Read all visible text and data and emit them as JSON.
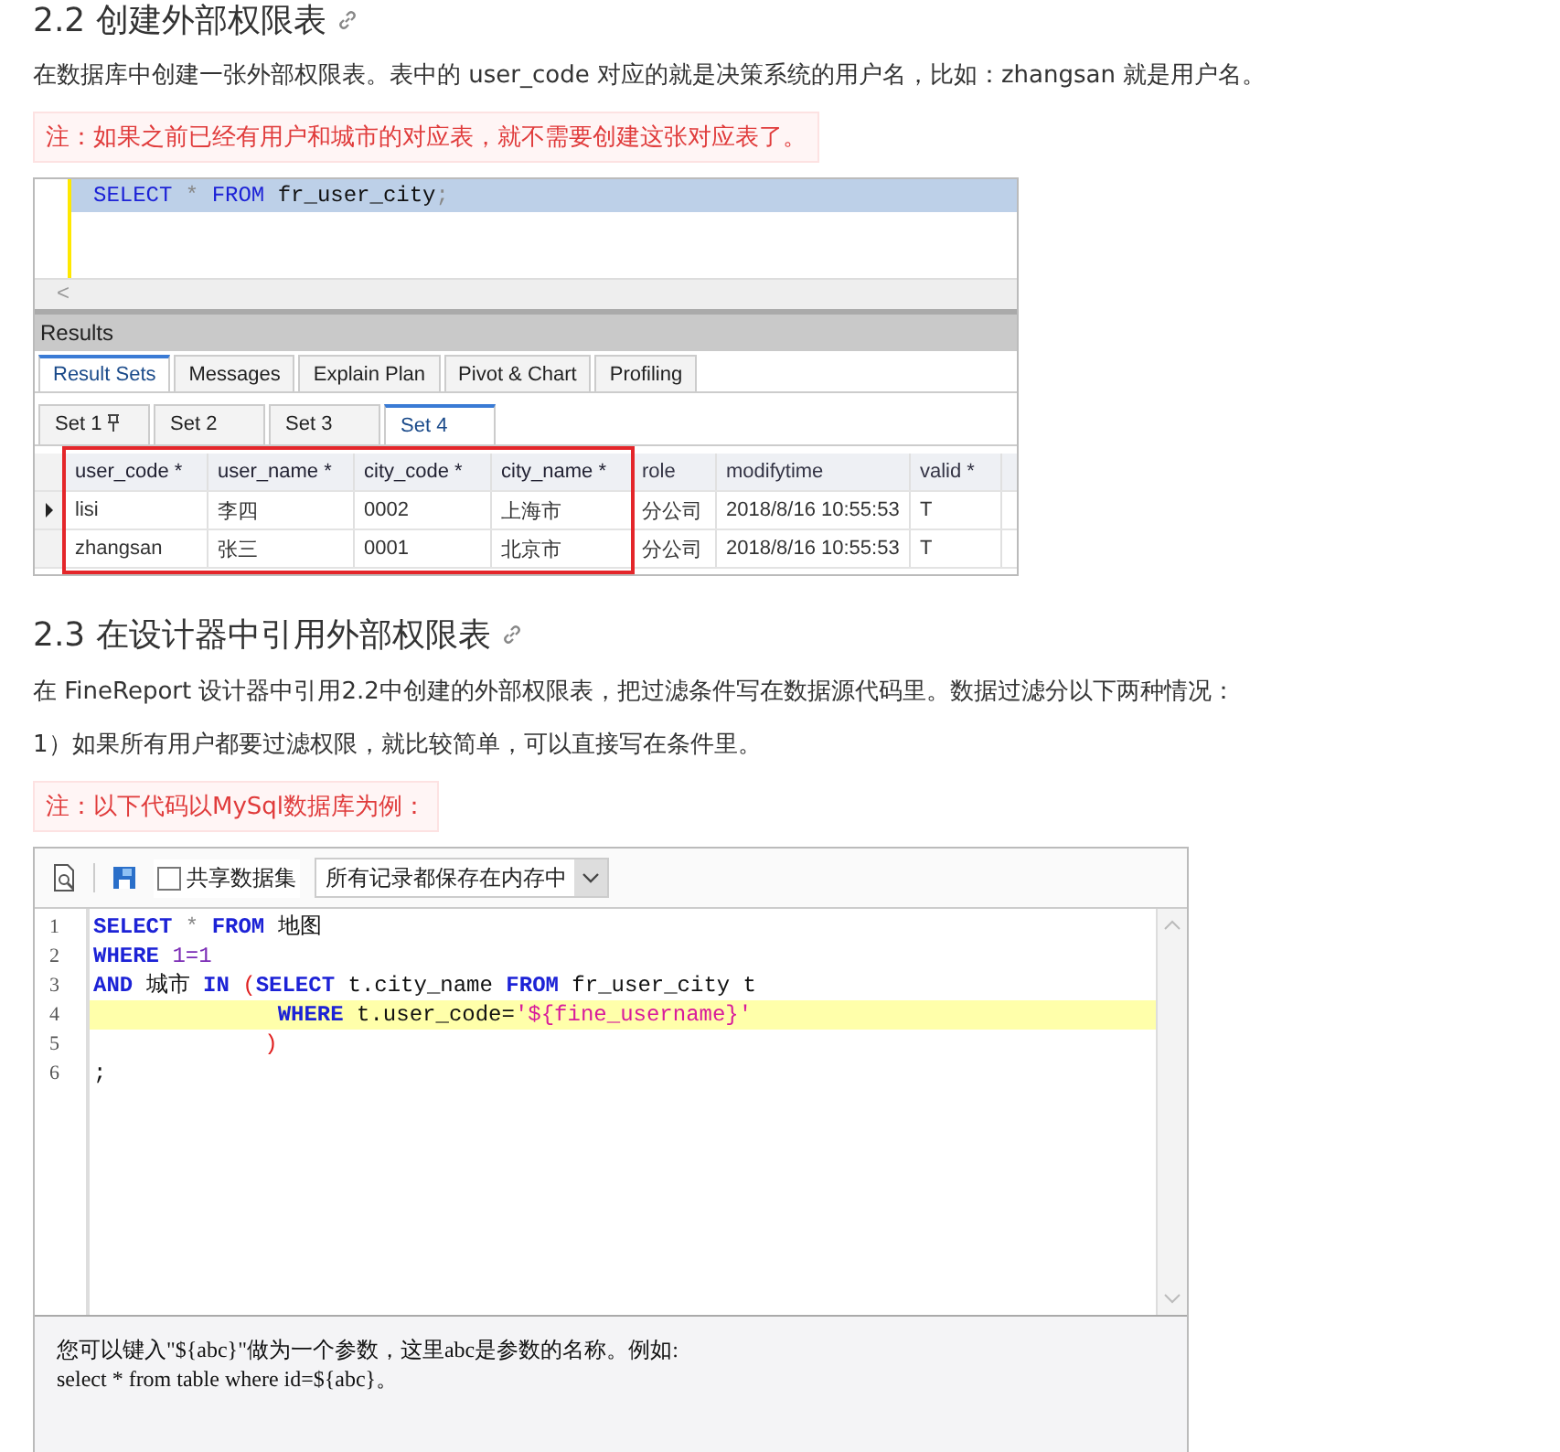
{
  "section_2_2": {
    "heading": "2.2 创建外部权限表",
    "paragraph": "在数据库中创建一张外部权限表。表中的 user_code 对应的就是决策系统的用户名，比如：zhangsan 就是用户名。",
    "note": "注：如果之前已经有用户和城市的对应表，就不需要创建这张对应表了。"
  },
  "query_screenshot": {
    "query": [
      {
        "kind": "kw",
        "text": "SELECT"
      },
      {
        "kind": "op",
        "text": " * "
      },
      {
        "kind": "kw",
        "text": "FROM"
      },
      {
        "kind": "plain",
        "text": " fr_user_city"
      },
      {
        "kind": "op",
        "text": ";"
      }
    ],
    "scroll_left": "<",
    "results_title": "Results",
    "tabs": [
      {
        "label": "Result Sets",
        "selected": true
      },
      {
        "label": "Messages",
        "selected": false
      },
      {
        "label": "Explain Plan",
        "selected": false
      },
      {
        "label": "Pivot & Chart",
        "selected": false
      },
      {
        "label": "Profiling",
        "selected": false
      }
    ],
    "set_tabs": [
      {
        "label": "Set 1",
        "pinned": true,
        "selected": false
      },
      {
        "label": "Set 2",
        "pinned": false,
        "selected": false
      },
      {
        "label": "Set 3",
        "pinned": false,
        "selected": false
      },
      {
        "label": "Set 4",
        "pinned": false,
        "selected": true
      }
    ],
    "columns": [
      {
        "label": "user_code *",
        "highlighted": true
      },
      {
        "label": "user_name *",
        "highlighted": true
      },
      {
        "label": "city_code *",
        "highlighted": true
      },
      {
        "label": "city_name *",
        "highlighted": true
      },
      {
        "label": "role",
        "highlighted": false
      },
      {
        "label": "modifytime",
        "highlighted": false
      },
      {
        "label": "valid *",
        "highlighted": false
      }
    ],
    "rows": [
      {
        "current": true,
        "cells": [
          "lisi",
          "李四",
          "0002",
          "上海市",
          "分公司",
          "2018/8/16 10:55:53",
          "T"
        ]
      },
      {
        "current": false,
        "cells": [
          "zhangsan",
          "张三",
          "0001",
          "北京市",
          "分公司",
          "2018/8/16 10:55:53",
          "T"
        ]
      }
    ]
  },
  "section_2_3": {
    "heading": "2.3 在设计器中引用外部权限表",
    "paragraphs": [
      "在 FineReport 设计器中引用2.2中创建的外部权限表，把过滤条件写在数据源代码里。数据过滤分以下两种情况：",
      "1）如果所有用户都要过滤权限，就比较简单，可以直接写在条件里。"
    ],
    "note": "注：以下代码以MySql数据库为例："
  },
  "designer_screenshot": {
    "share_dataset": {
      "label": "共享数据集",
      "checked": false
    },
    "storage_dropdown": "所有记录都保存在内存中",
    "code_lines": [
      {
        "number": "1",
        "highlighted": false,
        "tokens": [
          {
            "kind": "kw",
            "text": "SELECT"
          },
          {
            "kind": "op",
            "text": " * "
          },
          {
            "kind": "kw",
            "text": "FROM"
          },
          {
            "kind": "plain",
            "text": " 地图"
          }
        ]
      },
      {
        "number": "2",
        "highlighted": false,
        "tokens": [
          {
            "kind": "kw",
            "text": "WHERE"
          },
          {
            "kind": "num",
            "text": " 1=1"
          }
        ]
      },
      {
        "number": "3",
        "highlighted": false,
        "tokens": [
          {
            "kind": "kw",
            "text": "AND"
          },
          {
            "kind": "plain",
            "text": " 城市 "
          },
          {
            "kind": "kw",
            "text": "IN"
          },
          {
            "kind": "paren",
            "text": " ("
          },
          {
            "kind": "kw",
            "text": "SELECT"
          },
          {
            "kind": "plain",
            "text": " t.city_name "
          },
          {
            "kind": "kw",
            "text": "FROM"
          },
          {
            "kind": "plain",
            "text": " fr_user_city t"
          }
        ]
      },
      {
        "number": "4",
        "highlighted": true,
        "tokens": [
          {
            "kind": "kw",
            "text": "              WHERE"
          },
          {
            "kind": "plain",
            "text": " t.user_code="
          },
          {
            "kind": "str",
            "text": "'${fine_username}'"
          }
        ]
      },
      {
        "number": "5",
        "highlighted": false,
        "tokens": [
          {
            "kind": "paren",
            "text": "             )"
          }
        ]
      },
      {
        "number": "6",
        "highlighted": false,
        "tokens": [
          {
            "kind": "plain",
            "text": ";"
          }
        ]
      }
    ],
    "hint_lines": [
      "您可以键入\"${abc}\"做为一个参数，这里abc是参数的名称。例如:",
      "select * from table where id=${abc}。"
    ]
  }
}
